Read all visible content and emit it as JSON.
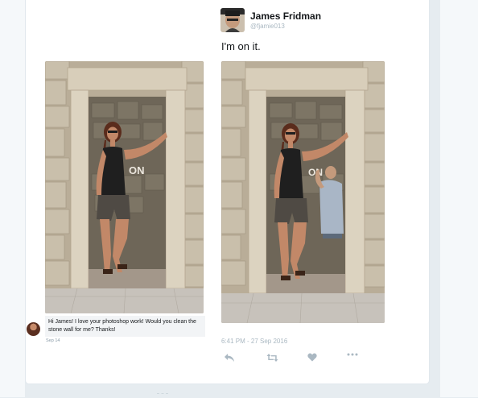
{
  "tweet": {
    "author_name": "James Fridman",
    "author_handle": "@fjamie013",
    "text": "I'm on it.",
    "timestamp": "6:41 PM - 27 Sep 2016"
  },
  "embedded_request": {
    "message": "Hi James! I love your photoshop work! Would you clean the stone wall for me? Thanks!",
    "date": "Sep 14"
  },
  "actions": [
    {
      "name": "reply-icon"
    },
    {
      "name": "retweet-icon"
    },
    {
      "name": "like-icon"
    },
    {
      "name": "more-icon"
    }
  ],
  "colors": {
    "text": "#14171a",
    "muted": "#aab8c2",
    "background": "#e6ecf0",
    "card": "#ffffff"
  }
}
